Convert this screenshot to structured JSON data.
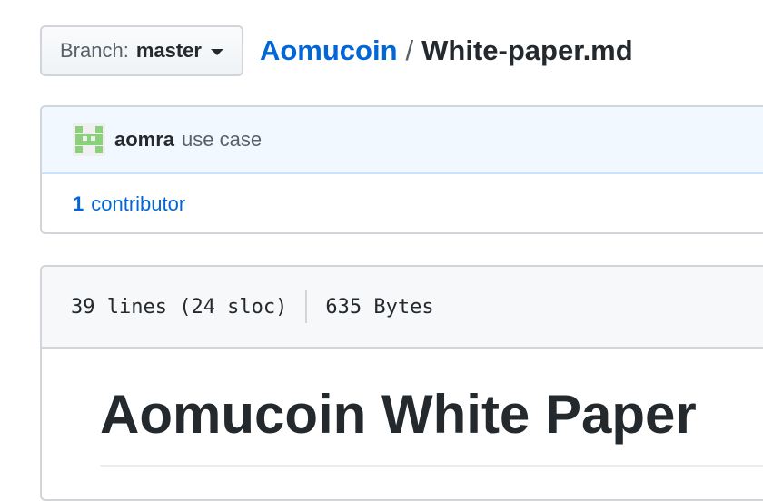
{
  "branch": {
    "prefix": "Branch:",
    "name": "master"
  },
  "breadcrumb": {
    "repo": "Aomucoin",
    "separator": "/",
    "file": "White-paper.md"
  },
  "commit": {
    "author": "aomra",
    "message": "use case"
  },
  "contributors": {
    "count": "1",
    "label": "contributor"
  },
  "file_info": {
    "lines": "39 lines (24 sloc)",
    "size": "635 Bytes"
  },
  "readme": {
    "title": "Aomucoin White Paper"
  },
  "colors": {
    "link": "#0366d6",
    "avatar": "#8bd07a"
  }
}
